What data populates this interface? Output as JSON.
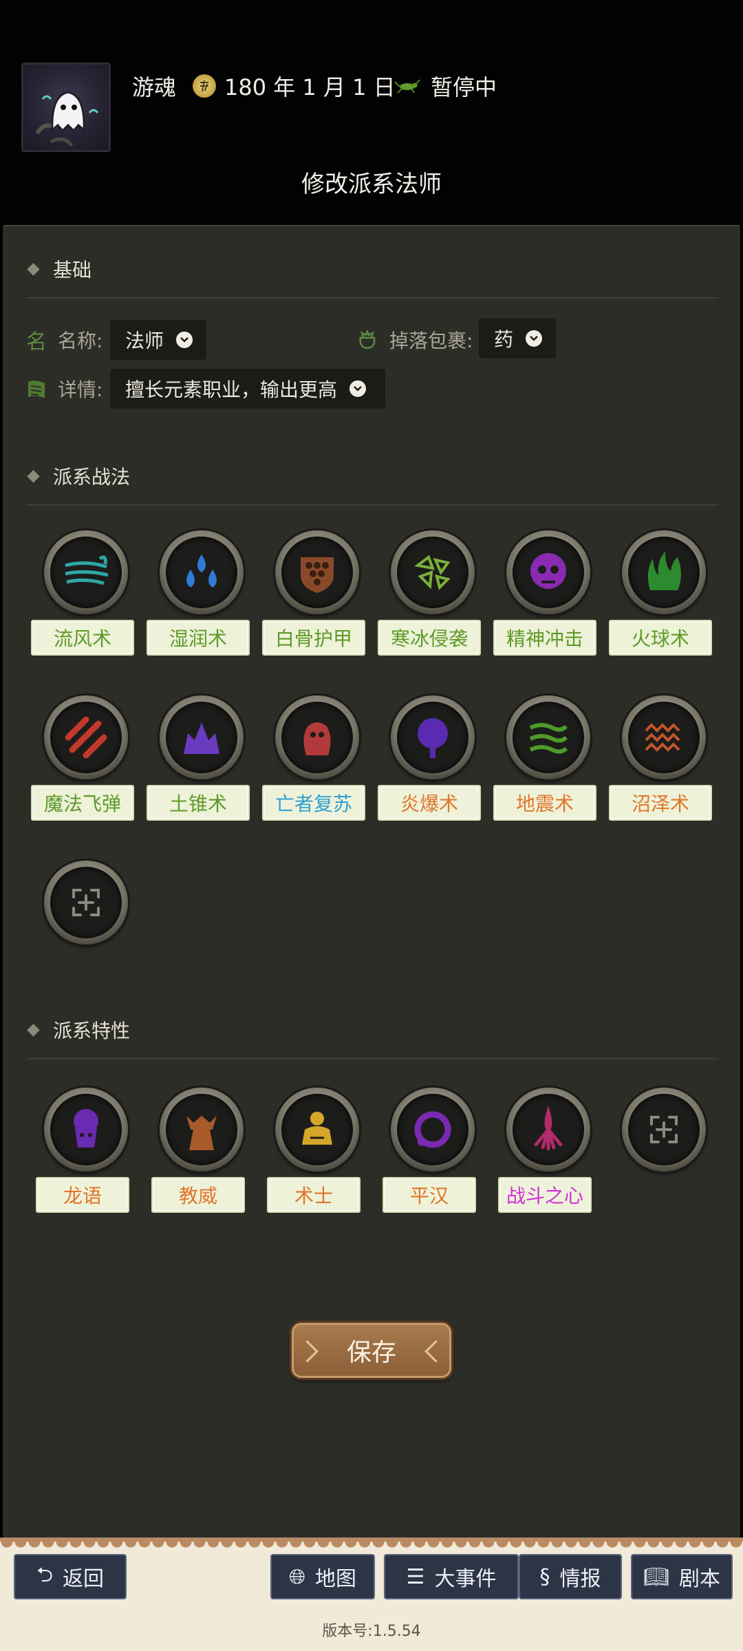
{
  "header": {
    "player_name": "游魂",
    "date": "180 年 1 月 1 日",
    "status": "暂停中",
    "title": "修改派系法师"
  },
  "basic": {
    "section_title": "基础",
    "name_label": "名称:",
    "name_value": "法师",
    "drop_label": "掉落包裹:",
    "drop_value": "药",
    "detail_label": "详情:",
    "detail_value": "擅长元素职业，输出更高"
  },
  "skills": {
    "section_title": "派系战法",
    "items": [
      {
        "label": "流风术",
        "color": "#5e9a2a",
        "icon": "wind-icon"
      },
      {
        "label": "湿润术",
        "color": "#5e9a2a",
        "icon": "water-drops-icon"
      },
      {
        "label": "白骨护甲",
        "color": "#5e9a2a",
        "icon": "bone-shield-icon"
      },
      {
        "label": "寒冰侵袭",
        "color": "#5e9a2a",
        "icon": "ice-shards-icon"
      },
      {
        "label": "精神冲击",
        "color": "#5e9a2a",
        "icon": "mind-skull-icon"
      },
      {
        "label": "火球术",
        "color": "#5e9a2a",
        "icon": "fire-icon"
      },
      {
        "label": "魔法飞弹",
        "color": "#5e9a2a",
        "icon": "missile-slash-icon"
      },
      {
        "label": "土锥术",
        "color": "#5e9a2a",
        "icon": "earth-spike-icon"
      },
      {
        "label": "亡者复苏",
        "color": "#2f9fd6",
        "icon": "undead-icon"
      },
      {
        "label": "炎爆术",
        "color": "#e0752a",
        "icon": "tree-burst-icon"
      },
      {
        "label": "地震术",
        "color": "#e0752a",
        "icon": "quake-icon"
      },
      {
        "label": "沼泽术",
        "color": "#e0752a",
        "icon": "swamp-waves-icon"
      }
    ],
    "add_icon": "add-slot-icon"
  },
  "traits": {
    "section_title": "派系特性",
    "items": [
      {
        "label": "龙语",
        "color": "#e0752a",
        "icon": "brain-face-icon"
      },
      {
        "label": "教威",
        "color": "#e0752a",
        "icon": "priest-icon"
      },
      {
        "label": "术士",
        "color": "#e0752a",
        "icon": "meditating-icon"
      },
      {
        "label": "平汉",
        "color": "#e0752a",
        "icon": "ring-icon"
      },
      {
        "label": "战斗之心",
        "color": "#d12fd6",
        "icon": "feather-heart-icon"
      }
    ],
    "add_icon": "add-slot-icon"
  },
  "save_label": "保存",
  "nav": {
    "back": "返回",
    "map": "地图",
    "events": "大事件",
    "intel": "情报",
    "script": "剧本"
  },
  "version": "版本号:1.5.54"
}
